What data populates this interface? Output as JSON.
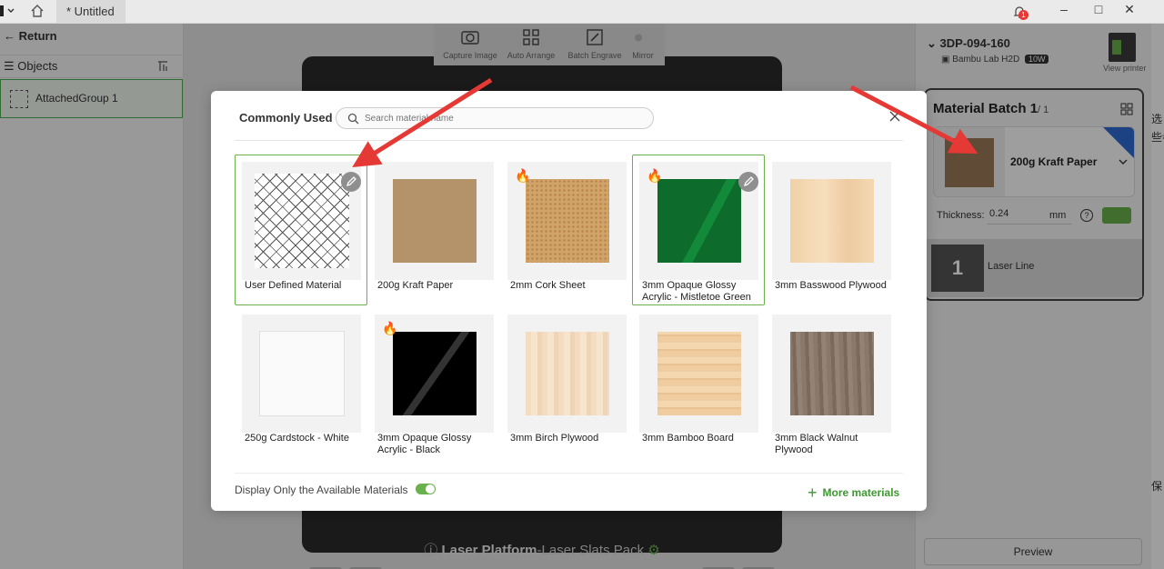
{
  "titlebar": {
    "tab_title": "* Untitled",
    "notification_count": "1",
    "logo_icon": "app-logo-icon",
    "home_icon": "home-icon",
    "bell_icon": "bell-icon"
  },
  "left_panel": {
    "return_label": "Return",
    "objects_label": "Objects",
    "objects": [
      {
        "name": "AttachedGroup 1"
      }
    ]
  },
  "toolbar": {
    "capture_label": "Capture Image",
    "arrange_label": "Auto Arrange",
    "engrave_label": "Batch Engrave",
    "mirror_label": "Mirror"
  },
  "plate": {
    "title_bold": "Laser Platform",
    "title_rest": "-Laser Slats Pack"
  },
  "right_panel": {
    "printer_name": "3DP-094-160",
    "printer_model": "Bambu Lab H2D",
    "laser_power": "10W",
    "view_printer": "View printer",
    "batch_title": "Material Batch 1",
    "batch_count": "/ 1",
    "material_name": "200g Kraft Paper",
    "thickness_label": "Thickness:",
    "thickness_value": "0.24",
    "thickness_unit": "mm",
    "help_symbol": "?",
    "laser_layer_index": "1",
    "laser_layer_name": "Laser Line",
    "preview_label": "Preview"
  },
  "far_right": {
    "texts": [
      "选",
      "些参",
      "保"
    ]
  },
  "dialog": {
    "title": "Commonly Used",
    "search_placeholder": "Search material name",
    "search_value": "",
    "materials": [
      {
        "label": "User Defined Material",
        "swatch": "grid",
        "hot": false,
        "editable": true,
        "selected": true
      },
      {
        "label": "200g Kraft Paper",
        "swatch": "kraft",
        "hot": false,
        "editable": false,
        "selected": false
      },
      {
        "label": "2mm Cork Sheet",
        "swatch": "cork",
        "hot": true,
        "editable": false,
        "selected": false
      },
      {
        "label": "3mm Opaque Glossy Acrylic - Mistletoe Green",
        "swatch": "green",
        "hot": true,
        "editable": true,
        "selected": true
      },
      {
        "label": "3mm Basswood Plywood",
        "swatch": "basswood",
        "hot": false,
        "editable": false,
        "selected": false
      },
      {
        "label": "250g Cardstock - White",
        "swatch": "white",
        "hot": false,
        "editable": false,
        "selected": false
      },
      {
        "label": "3mm Opaque Glossy Acrylic - Black",
        "swatch": "black",
        "hot": true,
        "editable": false,
        "selected": false
      },
      {
        "label": "3mm Birch Plywood",
        "swatch": "birch",
        "hot": false,
        "editable": false,
        "selected": false
      },
      {
        "label": "3mm Bamboo Board",
        "swatch": "bamboo",
        "hot": false,
        "editable": false,
        "selected": false
      },
      {
        "label": "3mm Black Walnut Plywood",
        "swatch": "walnut",
        "hot": false,
        "editable": false,
        "selected": false
      }
    ],
    "available_only_label": "Display Only the Available Materials",
    "available_only_on": true,
    "more_materials_label": "More materials"
  },
  "colors": {
    "accent_green": "#6ab04c",
    "annotation_red": "#e53935",
    "link_green": "#3c9a2f"
  }
}
